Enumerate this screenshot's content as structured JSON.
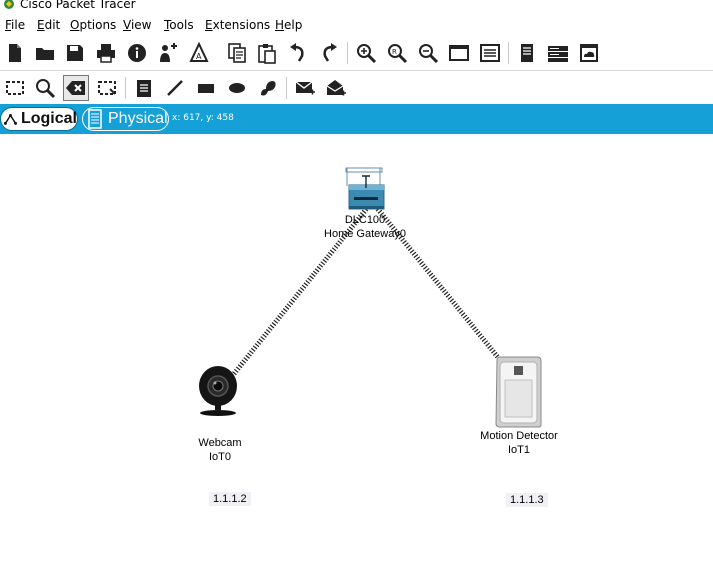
{
  "window": {
    "title": "Cisco Packet Tracer"
  },
  "menu": [
    "File",
    "Edit",
    "Options",
    "View",
    "Tools",
    "Extensions",
    "Help"
  ],
  "toolbar_main": [
    "new-file",
    "open-folder",
    "save",
    "print",
    "activity-wizard",
    "user-profile",
    "custom-device",
    "copy",
    "paste",
    "undo",
    "redo",
    "zoom-in",
    "zoom-reset",
    "zoom-out",
    "drawing-palette",
    "custom-device-dialog",
    "view-command-log",
    "server-rack",
    "cloud-view"
  ],
  "toolbar_tools": [
    "select",
    "inspect",
    "delete",
    "resize-shape",
    "place-note",
    "draw-line",
    "draw-rectangle",
    "draw-ellipse",
    "draw-freeform",
    "add-simple-pdu",
    "add-complex-pdu"
  ],
  "modes": {
    "logical": "Logical",
    "physical": "Physical"
  },
  "cursor_coords": "x: 617, y: 458",
  "devices": [
    {
      "id": "gateway",
      "line1": "DLC100",
      "line2": "Home Gateway0"
    },
    {
      "id": "webcam",
      "line1": "Webcam",
      "line2": "IoT0",
      "ip": "1.1.1.2"
    },
    {
      "id": "motion",
      "line1": "Motion Detector",
      "line2": "IoT1",
      "ip": "1.1.1.3"
    }
  ],
  "links": [
    {
      "from": "gateway",
      "to": "webcam",
      "type": "wireless"
    },
    {
      "from": "gateway",
      "to": "motion",
      "type": "wireless"
    }
  ]
}
